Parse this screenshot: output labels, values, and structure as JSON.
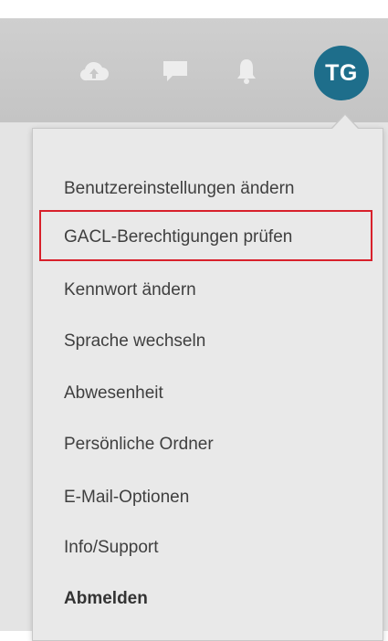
{
  "header": {
    "avatar_initials": "TG",
    "avatar_color": "#1e6e8b",
    "icons": [
      "cloud-upload-icon",
      "chat-icon",
      "bell-icon"
    ]
  },
  "menu": {
    "items": [
      {
        "label": "Benutzereinstellungen ändern"
      },
      {
        "label": "GACL-Berechtigungen prüfen",
        "highlighted": true
      },
      {
        "label": "Kennwort ändern"
      },
      {
        "label": "Sprache wechseln"
      },
      {
        "label": "Abwesenheit"
      },
      {
        "label": "Persönliche Ordner"
      },
      {
        "label": "E-Mail-Optionen"
      },
      {
        "label": "Info/Support"
      },
      {
        "label": "Abmelden",
        "bold": true
      }
    ],
    "highlight_color": "#d8202b"
  }
}
